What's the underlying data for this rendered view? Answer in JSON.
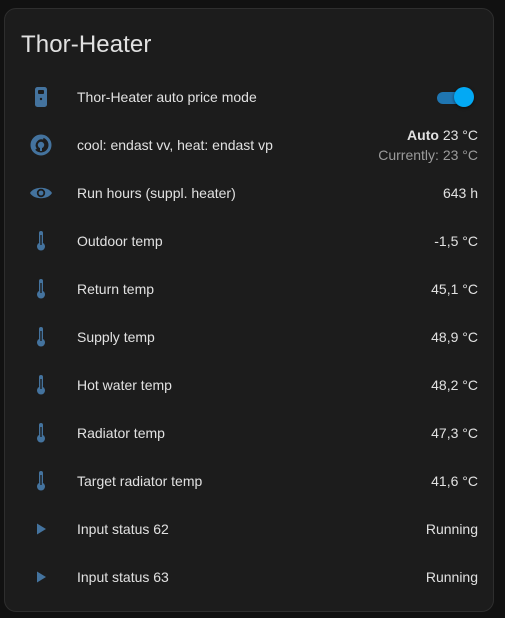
{
  "card": {
    "title": "Thor-Heater"
  },
  "colors": {
    "icon": "#44739e",
    "toggle_on": "#03a9f4",
    "text_primary": "#e1e1e1",
    "text_secondary": "#9b9b9b"
  },
  "rows": [
    {
      "name": "Thor-Heater auto price mode",
      "icon": "remote-icon",
      "type": "toggle",
      "toggle_on": true
    },
    {
      "name": "cool: endast vv, heat: endast vp",
      "icon": "thermostat-icon",
      "type": "climate",
      "mode": "Auto",
      "target": "23 °C",
      "current": "Currently: 23 °C"
    },
    {
      "name": "Run hours (suppl. heater)",
      "icon": "eye-icon",
      "type": "sensor",
      "state": "643 h"
    },
    {
      "name": "Outdoor temp",
      "icon": "thermometer-icon",
      "type": "sensor",
      "state": "-1,5 °C"
    },
    {
      "name": "Return temp",
      "icon": "thermometer-icon",
      "type": "sensor",
      "state": "45,1 °C"
    },
    {
      "name": "Supply temp",
      "icon": "thermometer-icon",
      "type": "sensor",
      "state": "48,9 °C"
    },
    {
      "name": "Hot water temp",
      "icon": "thermometer-icon",
      "type": "sensor",
      "state": "48,2 °C"
    },
    {
      "name": "Radiator temp",
      "icon": "thermometer-icon",
      "type": "sensor",
      "state": "47,3 °C"
    },
    {
      "name": "Target radiator temp",
      "icon": "thermometer-icon",
      "type": "sensor",
      "state": "41,6 °C"
    },
    {
      "name": "Input status 62",
      "icon": "play-icon",
      "type": "sensor",
      "state": "Running"
    },
    {
      "name": "Input status 63",
      "icon": "play-icon",
      "type": "sensor",
      "state": "Running"
    }
  ]
}
